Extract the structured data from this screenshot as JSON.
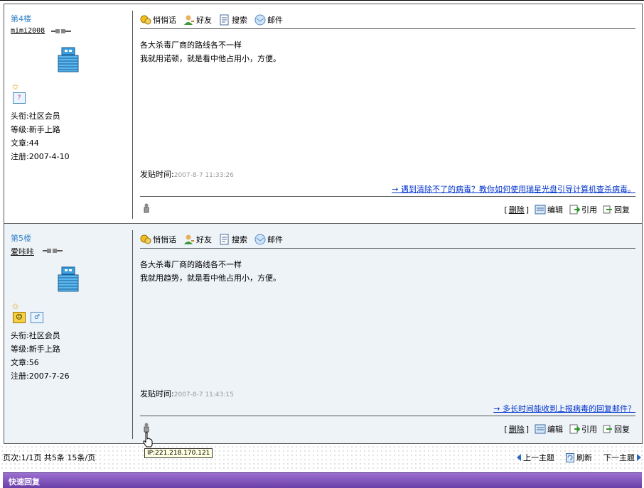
{
  "toolbar": {
    "msg_label": "悄悄话",
    "friend_label": "好友",
    "search_label": "搜索",
    "mail_label": "邮件"
  },
  "posts": [
    {
      "floor": "第4楼",
      "username": "mimi2008",
      "title_label": "头衔:社区会员",
      "level_label": "等级:新手上路",
      "articles_label": "文章:44",
      "register_label": "注册:2007-4-10",
      "body_line1": "各大杀毒厂商的路线各不一样",
      "body_line2": "我就用诺顿，就是看中他占用小，方便。",
      "time_label": "发贴时间:",
      "time_value": "2007-8-7 11:33:26",
      "related_link": "→ 遇到清除不了的病毒？教你如何使用瑞星光盘引导计算机查杀病毒。",
      "delete_label": "删除",
      "edit_label": "编辑",
      "quote_label": "引用",
      "reply_label": "回复"
    },
    {
      "floor": "第5楼",
      "username": "爱咔咔",
      "title_label": "头衔:社区会员",
      "level_label": "等级:新手上路",
      "articles_label": "文章:56",
      "register_label": "注册:2007-7-26",
      "body_line1": "各大杀毒厂商的路线各不一样",
      "body_line2": "我就用趋势，就是看中他占用小，方便。",
      "time_label": "发贴时间:",
      "time_value": "2007-8-7 11:43:15",
      "related_link": "→ 多长时间能收到上报病毒的回复邮件？",
      "delete_label": "删除",
      "edit_label": "编辑",
      "quote_label": "引用",
      "reply_label": "回复"
    }
  ],
  "pager": {
    "text": "页次:1/1页 共5条 15条/页"
  },
  "nav": {
    "prev": "上一主题",
    "refresh": "刷新",
    "next": "下一主题"
  },
  "tooltip": {
    "ip": "IP:221.218.170.121"
  },
  "quick_reply": {
    "title": "快速回复"
  },
  "colors": {
    "floor": "#3a86c8",
    "link": "#0033cc",
    "quickbar": "#7a4dbb"
  }
}
